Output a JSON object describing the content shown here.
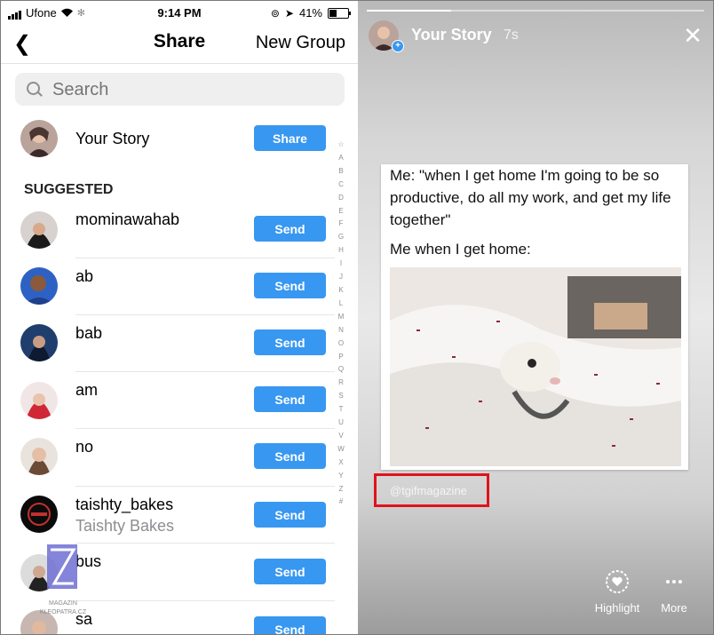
{
  "status_bar": {
    "carrier": "Ufone",
    "time": "9:14 PM",
    "battery_percent": "41%"
  },
  "nav": {
    "back_icon": "chevron-left-icon",
    "title": "Share",
    "right_action": "New Group"
  },
  "search": {
    "placeholder": "Search"
  },
  "your_story": {
    "label": "Your Story",
    "button": "Share"
  },
  "section_header": "SUGGESTED",
  "contacts": [
    {
      "name": "mominawahab",
      "subtitle": "",
      "button": "Send"
    },
    {
      "name": "ab",
      "subtitle": "",
      "button": "Send"
    },
    {
      "name": "bab",
      "subtitle": "",
      "button": "Send"
    },
    {
      "name": "am",
      "subtitle": "",
      "button": "Send"
    },
    {
      "name": "no",
      "subtitle": "",
      "button": "Send"
    },
    {
      "name": "taishty_bakes",
      "subtitle": "Taishty Bakes",
      "button": "Send"
    },
    {
      "name": "bus",
      "subtitle": "",
      "button": "Send"
    },
    {
      "name": "sa",
      "subtitle": "",
      "button": "Send"
    }
  ],
  "alphabet_index": [
    "☆",
    "A",
    "B",
    "C",
    "D",
    "E",
    "F",
    "G",
    "H",
    "I",
    "J",
    "K",
    "L",
    "M",
    "N",
    "O",
    "P",
    "Q",
    "R",
    "S",
    "T",
    "U",
    "V",
    "W",
    "X",
    "Y",
    "Z",
    "#"
  ],
  "watermark_text": "MAGAZIN\nKLEOPATRA.CZ",
  "story": {
    "progress": 0.25,
    "title": "Your Story",
    "time": "7s",
    "close_icon": "close-icon",
    "post_lines": [
      "Me: \"when I get home I'm going to be so",
      "productive, do all my work, and get my life",
      "together\""
    ],
    "post_line2": "Me when I get home:",
    "mention": "@tgifmagazine",
    "actions": [
      {
        "label": "Highlight",
        "icon": "heart-circle-icon"
      },
      {
        "label": "More",
        "icon": "more-dots-icon"
      }
    ]
  },
  "colors": {
    "accent": "#3897f0",
    "highlight_box": "#e0131b"
  }
}
